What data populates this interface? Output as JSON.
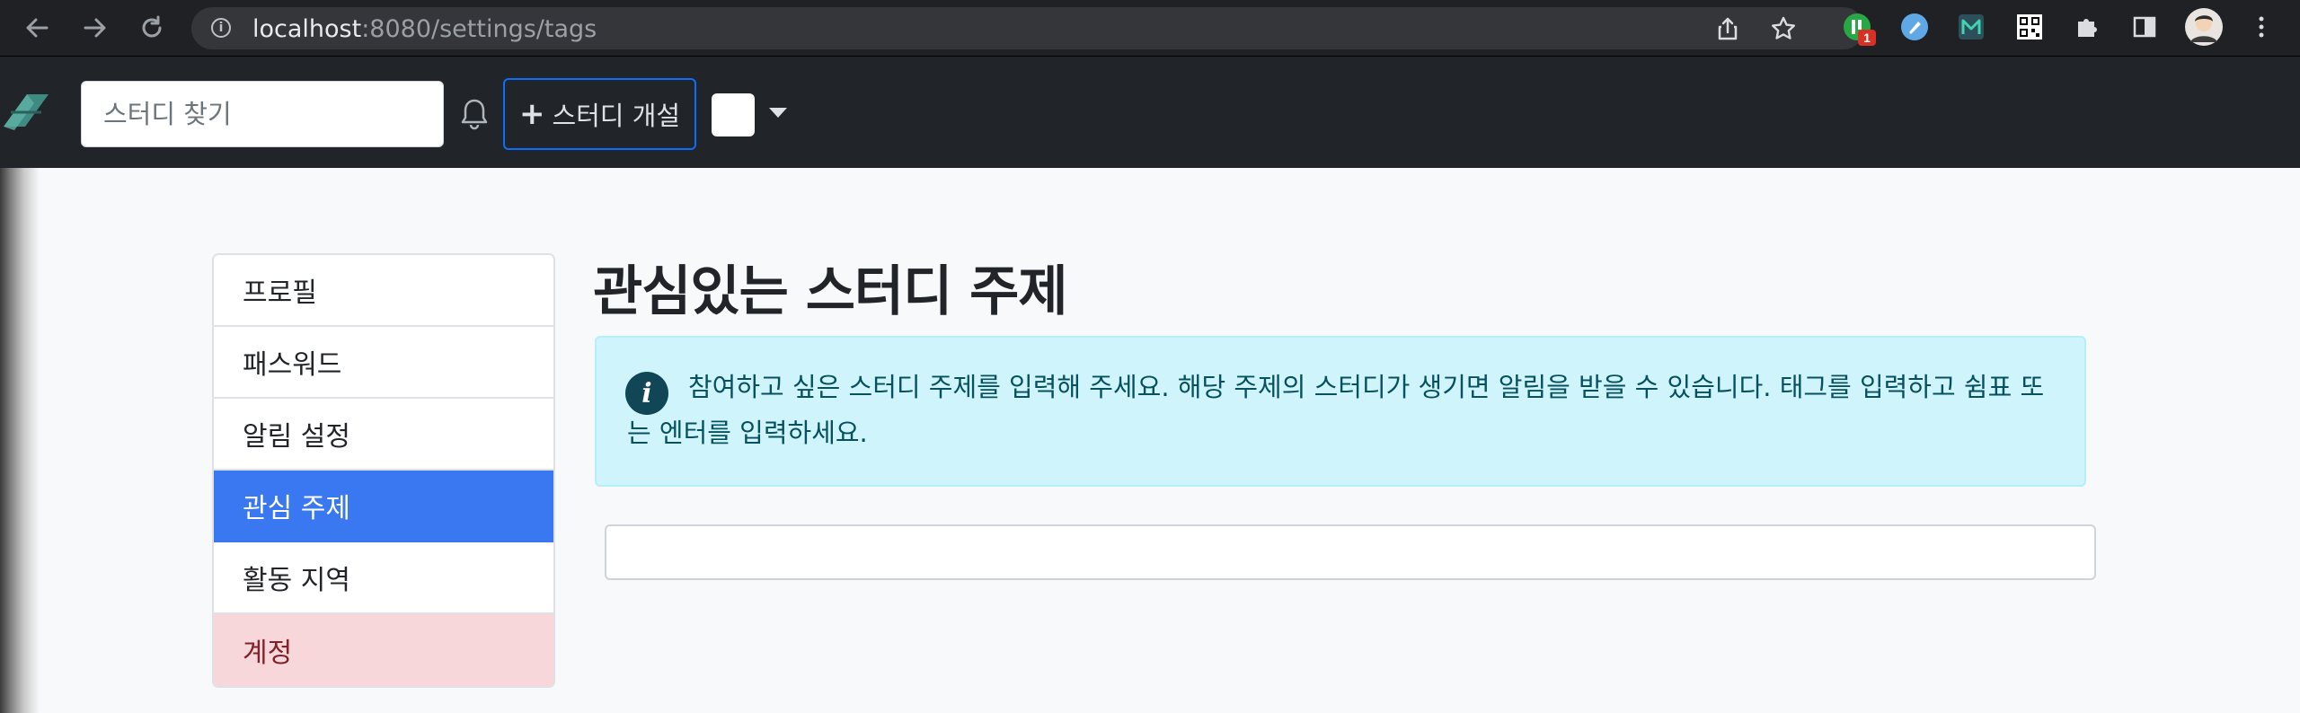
{
  "browser": {
    "url_host": "localhost",
    "url_path": ":8080/settings/tags",
    "extension_badge": "1"
  },
  "navbar": {
    "search_placeholder": "스터디 찾기",
    "create_study_label": "스터디 개설"
  },
  "sidebar": {
    "items": [
      {
        "label": "프로필"
      },
      {
        "label": "패스워드"
      },
      {
        "label": "알림 설정"
      },
      {
        "label": "관심 주제"
      },
      {
        "label": "활동 지역"
      },
      {
        "label": "계정"
      }
    ]
  },
  "main": {
    "title": "관심있는 스터디 주제",
    "alert_icon": "i",
    "alert_text": "참여하고 싶은 스터디 주제를 입력해 주세요. 해당 주제의 스터디가 생기면 알림을 받을 수 있습니다. 태그를 입력하고 쉼표 또는 엔터를 입력하세요.",
    "tag_input_value": ""
  },
  "colors": {
    "active": "#3a78f2",
    "danger_bg": "#f8d7da",
    "alert_bg": "#cff4fc",
    "navbar_bg": "#212529",
    "create_button_border": "#0d6efd"
  }
}
